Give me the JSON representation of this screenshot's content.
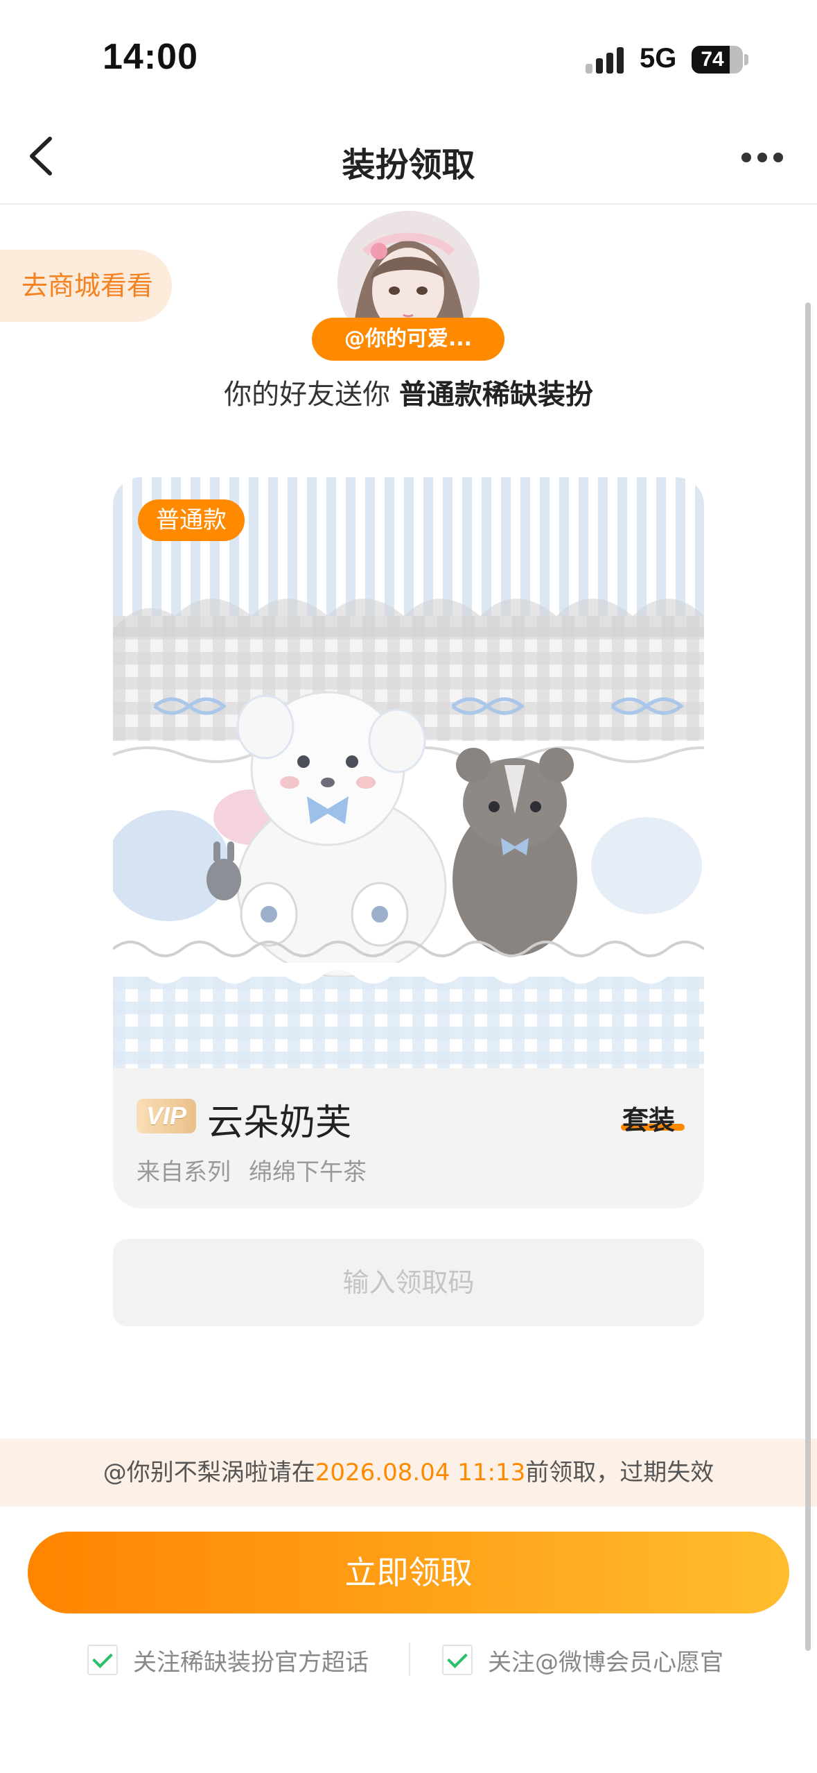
{
  "status_bar": {
    "time": "14:00",
    "network": "5G",
    "battery": "74",
    "battery_level": 0.74
  },
  "nav": {
    "title": "装扮领取"
  },
  "shop_link": "去商城看看",
  "sender": {
    "name": "@你的可爱..."
  },
  "gift": {
    "prefix": "你的好友送你 ",
    "item_type": "普通款稀缺装扮"
  },
  "card": {
    "tag": "普通款",
    "vip_label": "VIP",
    "name": "云朵奶芙",
    "type_label": "套装",
    "series_label": "来自系列",
    "series_name": "绵绵下午茶"
  },
  "code_input": {
    "placeholder": "输入领取码",
    "value": ""
  },
  "notice": {
    "prefix": "@你别不梨涡啦请在",
    "deadline": "2026.08.04 11:13",
    "suffix": "前领取，过期失效"
  },
  "claim_button": "立即领取",
  "follow_options": [
    {
      "label": "关注稀缺装扮官方超话",
      "checked": true
    },
    {
      "label": "关注@微博会员心愿官",
      "checked": true
    }
  ],
  "colors": {
    "accent": "#ff8a00",
    "notice_bg": "#fdf1e7",
    "check": "#2bbf6a"
  }
}
